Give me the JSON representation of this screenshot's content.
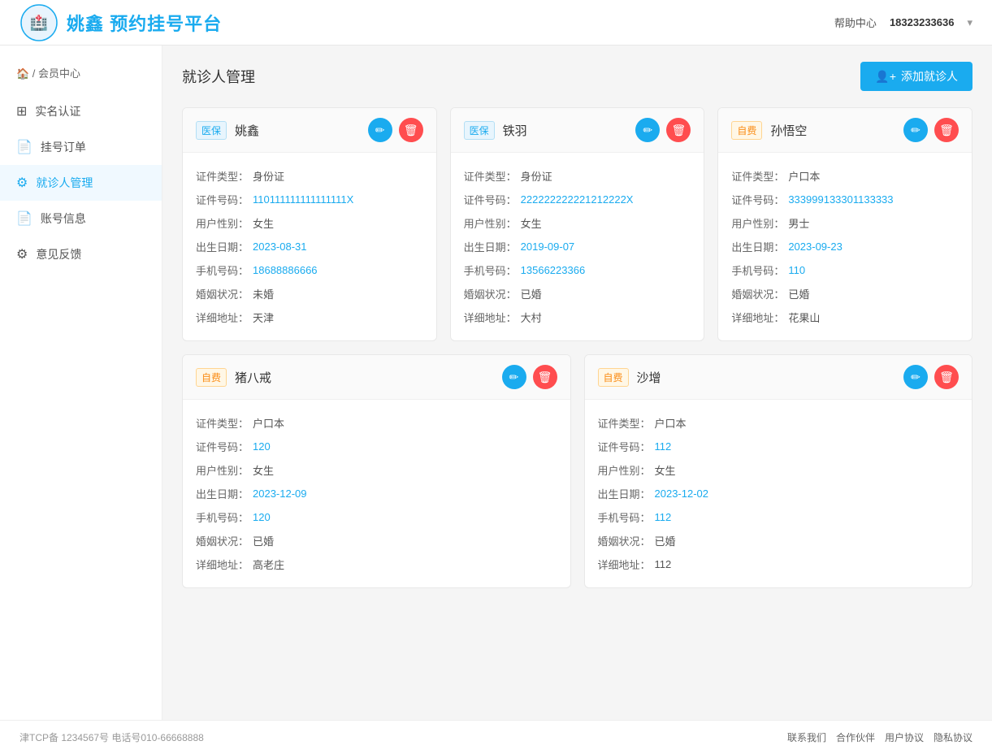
{
  "header": {
    "logo_text": "姚鑫 预约挂号平台",
    "help_label": "帮助中心",
    "phone": "18323233636"
  },
  "sidebar": {
    "breadcrumb": "🏠 / 会员中心",
    "items": [
      {
        "id": "realname",
        "icon": "⊞",
        "label": "实名认证",
        "active": false
      },
      {
        "id": "orders",
        "icon": "📄",
        "label": "挂号订单",
        "active": false
      },
      {
        "id": "patients",
        "icon": "⚙",
        "label": "就诊人管理",
        "active": true
      },
      {
        "id": "account",
        "icon": "📄",
        "label": "账号信息",
        "active": false
      },
      {
        "id": "feedback",
        "icon": "⚙",
        "label": "意见反馈",
        "active": false
      }
    ]
  },
  "main": {
    "title": "就诊人管理",
    "add_btn": "添加就诊人",
    "cards_top": [
      {
        "badge_type": "medical",
        "badge_label": "医保",
        "name": "姚鑫",
        "fields": [
          {
            "label": "证件类型：",
            "value": "身份证",
            "highlight": false
          },
          {
            "label": "证件号码：",
            "value": "110111111111111111X",
            "highlight": true
          },
          {
            "label": "用户性别：",
            "value": "女生",
            "highlight": false
          },
          {
            "label": "出生日期：",
            "value": "2023-08-31",
            "highlight": true
          },
          {
            "label": "手机号码：",
            "value": "18688886666",
            "highlight": true
          },
          {
            "label": "婚姻状况：",
            "value": "未婚",
            "highlight": false
          },
          {
            "label": "详细地址：",
            "value": "天津",
            "highlight": false
          }
        ]
      },
      {
        "badge_type": "medical",
        "badge_label": "医保",
        "name": "铁羽",
        "fields": [
          {
            "label": "证件类型：",
            "value": "身份证",
            "highlight": false
          },
          {
            "label": "证件号码：",
            "value": "222222222221212222X",
            "highlight": true
          },
          {
            "label": "用户性别：",
            "value": "女生",
            "highlight": false
          },
          {
            "label": "出生日期：",
            "value": "2019-09-07",
            "highlight": true
          },
          {
            "label": "手机号码：",
            "value": "13566223366",
            "highlight": true
          },
          {
            "label": "婚姻状况：",
            "value": "已婚",
            "highlight": false
          },
          {
            "label": "详细地址：",
            "value": "大村",
            "highlight": false
          }
        ]
      },
      {
        "badge_type": "selfpay",
        "badge_label": "自费",
        "name": "孙悟空",
        "fields": [
          {
            "label": "证件类型：",
            "value": "户口本",
            "highlight": false
          },
          {
            "label": "证件号码：",
            "value": "333999133301133333",
            "highlight": true
          },
          {
            "label": "用户性别：",
            "value": "男士",
            "highlight": false
          },
          {
            "label": "出生日期：",
            "value": "2023-09-23",
            "highlight": true
          },
          {
            "label": "手机号码：",
            "value": "110",
            "highlight": true
          },
          {
            "label": "婚姻状况：",
            "value": "已婚",
            "highlight": false
          },
          {
            "label": "详细地址：",
            "value": "花果山",
            "highlight": false
          }
        ]
      }
    ],
    "cards_bottom": [
      {
        "badge_type": "selfpay",
        "badge_label": "自费",
        "name": "猪八戒",
        "fields": [
          {
            "label": "证件类型：",
            "value": "户口本",
            "highlight": false
          },
          {
            "label": "证件号码：",
            "value": "120",
            "highlight": true
          },
          {
            "label": "用户性别：",
            "value": "女生",
            "highlight": false
          },
          {
            "label": "出生日期：",
            "value": "2023-12-09",
            "highlight": true
          },
          {
            "label": "手机号码：",
            "value": "120",
            "highlight": true
          },
          {
            "label": "婚姻状况：",
            "value": "已婚",
            "highlight": false
          },
          {
            "label": "详细地址：",
            "value": "高老庄",
            "highlight": false
          }
        ]
      },
      {
        "badge_type": "selfpay",
        "badge_label": "自费",
        "name": "沙增",
        "fields": [
          {
            "label": "证件类型：",
            "value": "户口本",
            "highlight": false
          },
          {
            "label": "证件号码：",
            "value": "112",
            "highlight": true
          },
          {
            "label": "用户性别：",
            "value": "女生",
            "highlight": false
          },
          {
            "label": "出生日期：",
            "value": "2023-12-02",
            "highlight": true
          },
          {
            "label": "手机号码：",
            "value": "112",
            "highlight": true
          },
          {
            "label": "婚姻状况：",
            "value": "已婚",
            "highlight": false
          },
          {
            "label": "详细地址：",
            "value": "112",
            "highlight": false
          }
        ]
      }
    ]
  },
  "footer": {
    "icp": "津TCP备 1234567号 电话号010-66668888",
    "links": [
      "联系我们",
      "合作伙伴",
      "用户协议",
      "隐私协议"
    ]
  }
}
